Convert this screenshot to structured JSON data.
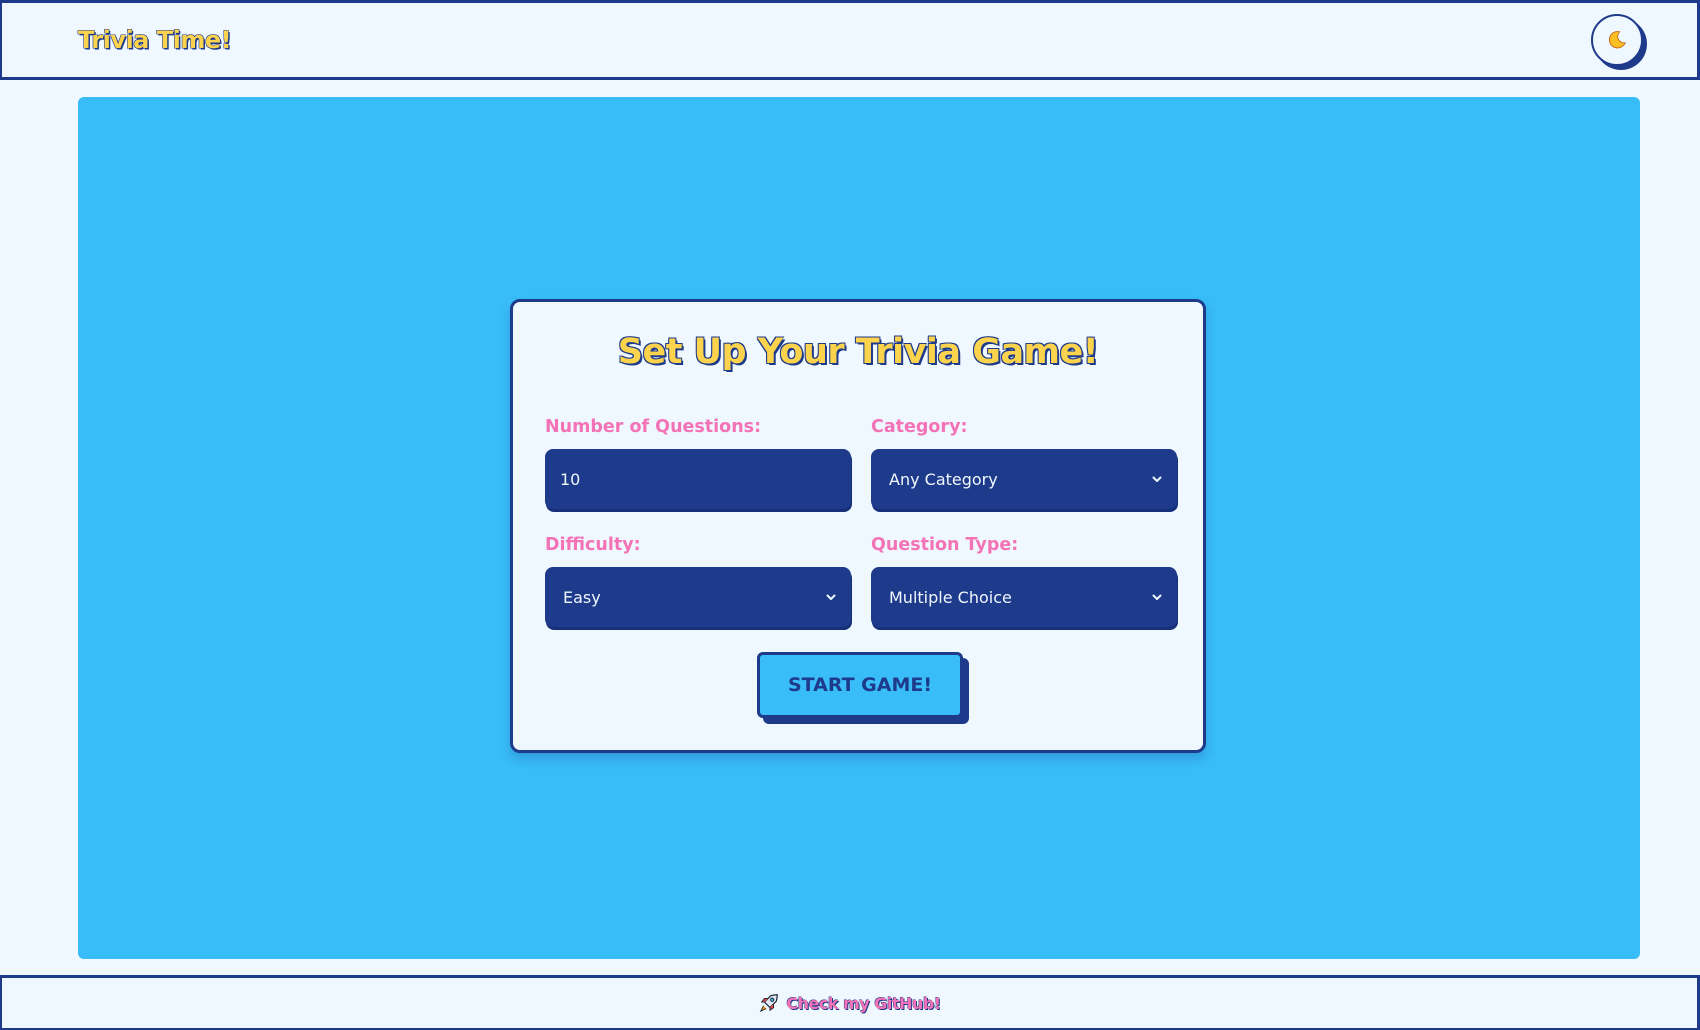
{
  "header": {
    "title": "Trivia Time!",
    "theme_toggle_icon": "moon-icon"
  },
  "setup": {
    "title": "Set Up Your Trivia Game!",
    "num_questions": {
      "label": "Number of Questions:",
      "value": "10"
    },
    "category": {
      "label": "Category:",
      "value": "Any Category"
    },
    "difficulty": {
      "label": "Difficulty:",
      "value": "Easy"
    },
    "question_type": {
      "label": "Question Type:",
      "value": "Multiple Choice"
    },
    "start_label": "START GAME!"
  },
  "footer": {
    "link_icon": "rocket-icon",
    "link_text": "Check my GitHub!"
  },
  "colors": {
    "navy": "#1e3a8a",
    "sky": "#38bdf8",
    "background": "#f0f8ff",
    "yellow": "#fcd34d",
    "pink": "#f472b6"
  }
}
